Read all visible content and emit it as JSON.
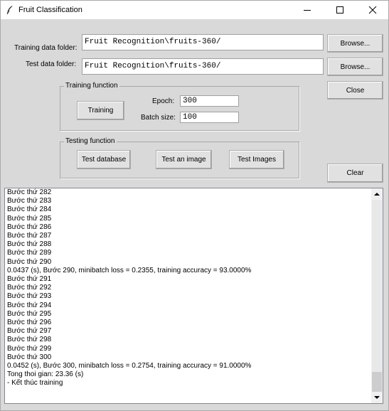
{
  "window": {
    "title": "Fruit Classification"
  },
  "form": {
    "training_folder_label": "Training data folder:",
    "training_folder_value": "Fruit Recognition\\fruits-360/",
    "test_folder_label": "Test data folder:",
    "test_folder_value": "Fruit Recognition\\fruits-360/",
    "browse_label": "Browse...",
    "close_label": "Close",
    "clear_label": "Clear"
  },
  "training_group": {
    "legend": "Training function",
    "training_button": "Training",
    "epoch_label": "Epoch:",
    "epoch_value": "300",
    "batch_label": "Batch size:",
    "batch_value": "100"
  },
  "testing_group": {
    "legend": "Testing function",
    "test_database": "Test database",
    "test_image": "Test an image",
    "test_images": "Test Images"
  },
  "log": [
    "Bước thứ 282",
    "Bước thứ 283",
    "Bước thứ 284",
    "Bước thứ 285",
    "Bước thứ 286",
    "Bước thứ 287",
    "Bước thứ 288",
    "Bước thứ 289",
    "Bước thứ 290",
    "0.0437 (s), Bước 290, minibatch loss = 0.2355, training accuracy = 93.0000%",
    "Bước thứ 291",
    "Bước thứ 292",
    "Bước thứ 293",
    "Bước thứ 294",
    "Bước thứ 295",
    "Bước thứ 296",
    "Bước thứ 297",
    "Bước thứ 298",
    "Bước thứ 299",
    "Bước thứ 300",
    "0.0452 (s), Bước 300, minibatch loss = 0.2754, training accuracy = 91.0000%",
    "Tong thoi gian: 23.36 (s)",
    "- Kết thúc training",
    ""
  ]
}
